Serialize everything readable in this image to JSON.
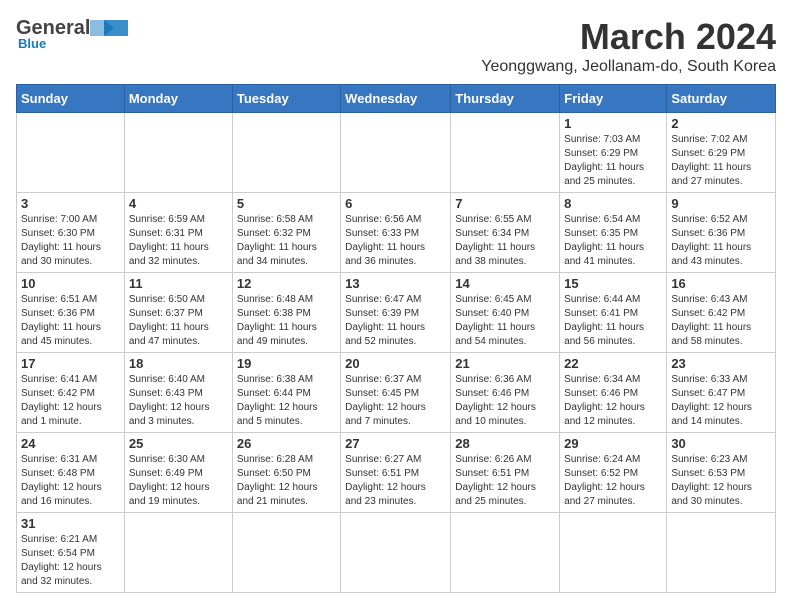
{
  "logo": {
    "line1": "General",
    "line2": "Blue"
  },
  "title": "March 2024",
  "subtitle": "Yeonggwang, Jeollanam-do, South Korea",
  "weekdays": [
    "Sunday",
    "Monday",
    "Tuesday",
    "Wednesday",
    "Thursday",
    "Friday",
    "Saturday"
  ],
  "days": {
    "1": "Sunrise: 7:03 AM\nSunset: 6:29 PM\nDaylight: 11 hours\nand 25 minutes.",
    "2": "Sunrise: 7:02 AM\nSunset: 6:29 PM\nDaylight: 11 hours\nand 27 minutes.",
    "3": "Sunrise: 7:00 AM\nSunset: 6:30 PM\nDaylight: 11 hours\nand 30 minutes.",
    "4": "Sunrise: 6:59 AM\nSunset: 6:31 PM\nDaylight: 11 hours\nand 32 minutes.",
    "5": "Sunrise: 6:58 AM\nSunset: 6:32 PM\nDaylight: 11 hours\nand 34 minutes.",
    "6": "Sunrise: 6:56 AM\nSunset: 6:33 PM\nDaylight: 11 hours\nand 36 minutes.",
    "7": "Sunrise: 6:55 AM\nSunset: 6:34 PM\nDaylight: 11 hours\nand 38 minutes.",
    "8": "Sunrise: 6:54 AM\nSunset: 6:35 PM\nDaylight: 11 hours\nand 41 minutes.",
    "9": "Sunrise: 6:52 AM\nSunset: 6:36 PM\nDaylight: 11 hours\nand 43 minutes.",
    "10": "Sunrise: 6:51 AM\nSunset: 6:36 PM\nDaylight: 11 hours\nand 45 minutes.",
    "11": "Sunrise: 6:50 AM\nSunset: 6:37 PM\nDaylight: 11 hours\nand 47 minutes.",
    "12": "Sunrise: 6:48 AM\nSunset: 6:38 PM\nDaylight: 11 hours\nand 49 minutes.",
    "13": "Sunrise: 6:47 AM\nSunset: 6:39 PM\nDaylight: 11 hours\nand 52 minutes.",
    "14": "Sunrise: 6:45 AM\nSunset: 6:40 PM\nDaylight: 11 hours\nand 54 minutes.",
    "15": "Sunrise: 6:44 AM\nSunset: 6:41 PM\nDaylight: 11 hours\nand 56 minutes.",
    "16": "Sunrise: 6:43 AM\nSunset: 6:42 PM\nDaylight: 11 hours\nand 58 minutes.",
    "17": "Sunrise: 6:41 AM\nSunset: 6:42 PM\nDaylight: 12 hours\nand 1 minute.",
    "18": "Sunrise: 6:40 AM\nSunset: 6:43 PM\nDaylight: 12 hours\nand 3 minutes.",
    "19": "Sunrise: 6:38 AM\nSunset: 6:44 PM\nDaylight: 12 hours\nand 5 minutes.",
    "20": "Sunrise: 6:37 AM\nSunset: 6:45 PM\nDaylight: 12 hours\nand 7 minutes.",
    "21": "Sunrise: 6:36 AM\nSunset: 6:46 PM\nDaylight: 12 hours\nand 10 minutes.",
    "22": "Sunrise: 6:34 AM\nSunset: 6:46 PM\nDaylight: 12 hours\nand 12 minutes.",
    "23": "Sunrise: 6:33 AM\nSunset: 6:47 PM\nDaylight: 12 hours\nand 14 minutes.",
    "24": "Sunrise: 6:31 AM\nSunset: 6:48 PM\nDaylight: 12 hours\nand 16 minutes.",
    "25": "Sunrise: 6:30 AM\nSunset: 6:49 PM\nDaylight: 12 hours\nand 19 minutes.",
    "26": "Sunrise: 6:28 AM\nSunset: 6:50 PM\nDaylight: 12 hours\nand 21 minutes.",
    "27": "Sunrise: 6:27 AM\nSunset: 6:51 PM\nDaylight: 12 hours\nand 23 minutes.",
    "28": "Sunrise: 6:26 AM\nSunset: 6:51 PM\nDaylight: 12 hours\nand 25 minutes.",
    "29": "Sunrise: 6:24 AM\nSunset: 6:52 PM\nDaylight: 12 hours\nand 27 minutes.",
    "30": "Sunrise: 6:23 AM\nSunset: 6:53 PM\nDaylight: 12 hours\nand 30 minutes.",
    "31": "Sunrise: 6:21 AM\nSunset: 6:54 PM\nDaylight: 12 hours\nand 32 minutes."
  }
}
